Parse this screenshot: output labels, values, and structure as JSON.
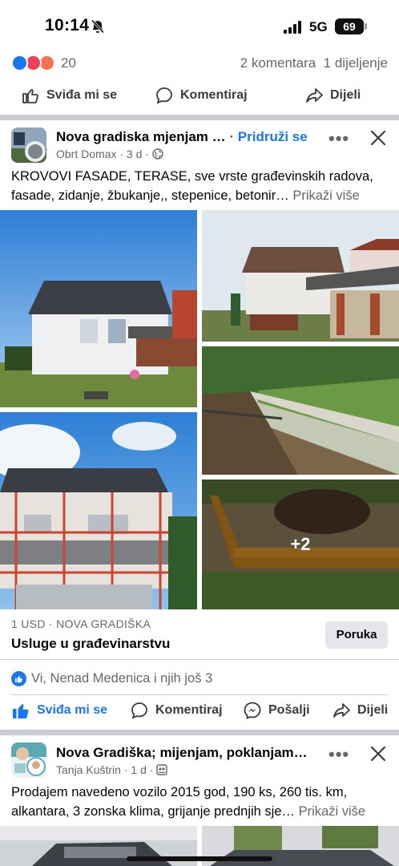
{
  "status_bar": {
    "time": "10:14",
    "network": "5G",
    "battery": "69"
  },
  "prev_post": {
    "reaction_count": "20",
    "comments_shares": "2 komentara  1 dijeljenje",
    "actions": {
      "like": "Sviđa mi se",
      "comment": "Komentiraj",
      "share": "Dijeli"
    }
  },
  "post": {
    "group": "Nova gradiska mjenjam …",
    "join": "Pridruži se",
    "author": "Obrt Domax",
    "time": "3 d",
    "text": "KROVOVI FASADE, TERASE, sve vrste građevinskih radova, fasade, zidanje, žbukanje,,  stepenice, betonir…",
    "see_more": "Prikaži više",
    "extra_photos": "+2",
    "listing": {
      "meta": "1 USD · NOVA GRADIŠKA",
      "title": "Usluge u građevinarstvu",
      "message_button": "Poruka"
    },
    "likes": "Vi, Nenad Medenica i njih još 3",
    "actions": {
      "like": "Sviđa mi se",
      "comment": "Komentiraj",
      "send": "Pošalji",
      "share": "Dijeli"
    }
  },
  "next_post": {
    "group": "Nova Gradiška; mijenjam, poklanjam…",
    "author": "Tanja Kuštrin",
    "time": "1 d",
    "text": "Prodajem navedeno vozilo 2015 god, 190 ks, 260 tis. km, alkantara, 3 zonska klima, grijanje prednjih sje…",
    "see_more": "Prikaži više"
  },
  "colors": {
    "accent": "#1877f2",
    "text": "#050505",
    "muted": "#65676b",
    "separator": "#c9ccd1"
  }
}
